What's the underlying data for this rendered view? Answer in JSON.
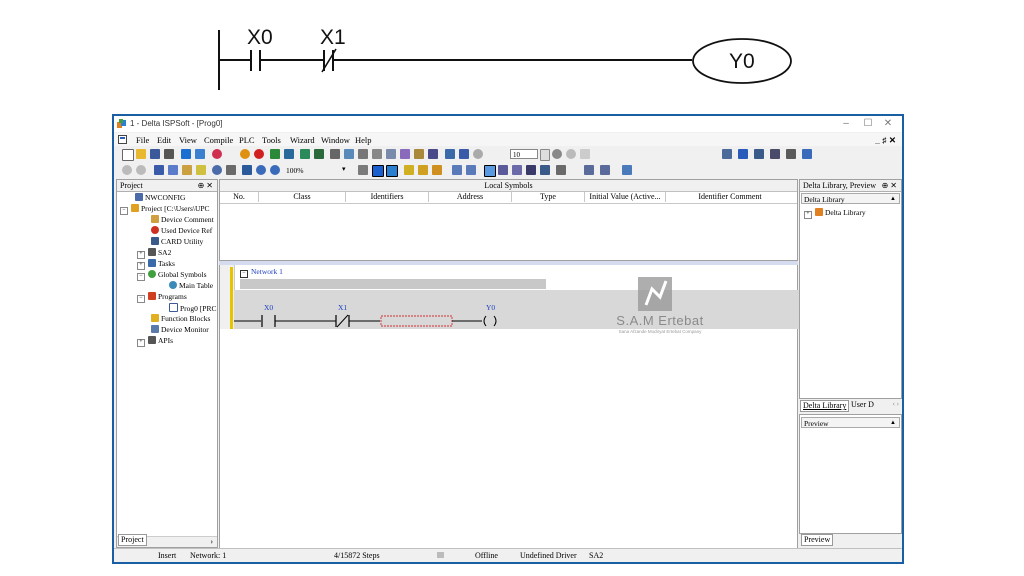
{
  "diagram": {
    "contact_1": "X0",
    "contact_2": "X1",
    "coil": "Y0"
  },
  "window": {
    "title": "1 - Delta ISPSoft - [Prog0]",
    "minimize": "–",
    "maximize": "☐",
    "close": "✕",
    "inner_controls": "_ ♯ ✕"
  },
  "menu": [
    {
      "id": "file",
      "label": "File"
    },
    {
      "id": "edit",
      "label": "Edit"
    },
    {
      "id": "view",
      "label": "View"
    },
    {
      "id": "compile",
      "label": "Compile"
    },
    {
      "id": "plc",
      "label": "PLC"
    },
    {
      "id": "tools",
      "label": "Tools"
    },
    {
      "id": "wizard",
      "label": "Wizard"
    },
    {
      "id": "window",
      "label": "Window"
    },
    {
      "id": "help",
      "label": "Help"
    }
  ],
  "toolbar": {
    "zoom": "100%",
    "spin_value": "10"
  },
  "project_panel": {
    "title": "Project",
    "pin": "⊕ ✕",
    "tree": [
      {
        "label": "NWCONFIG"
      },
      {
        "label": "Project [C:\\Users\\UPC"
      },
      {
        "label": "Device Comment"
      },
      {
        "label": "Used Device Ref"
      },
      {
        "label": "CARD Utility"
      },
      {
        "label": "SA2"
      },
      {
        "label": "Tasks"
      },
      {
        "label": "Global Symbols"
      },
      {
        "label": "Main Table"
      },
      {
        "label": "Programs"
      },
      {
        "label": "Prog0 [PRC"
      },
      {
        "label": "Function Blocks"
      },
      {
        "label": "Device Monitor"
      },
      {
        "label": "APIs"
      }
    ],
    "bottom_tab": "Project"
  },
  "local_symbols": {
    "title": "Local Symbols",
    "columns": [
      "No.",
      "Class",
      "Identifiers",
      "Address",
      "Type",
      "Initial Value (Active...",
      "Identifier Comment"
    ]
  },
  "ladder": {
    "network_label": "Network 1",
    "contact_1": "X0",
    "contact_2": "X1",
    "coil": "Y0"
  },
  "watermark": {
    "name": "S.A.M Ertebat",
    "tagline": "Sana Afzande Modiryat Ertebat Company"
  },
  "library_panel": {
    "title": "Delta Library, Preview",
    "pin": "⊕ ✕",
    "dropdown": "Delta Library",
    "tree_item": "Delta Library",
    "tab_active": "Delta Library",
    "tab_other": "User D",
    "preview_dropdown": "Preview",
    "preview_tab": "Preview"
  },
  "statusbar": {
    "mode": "Insert",
    "network": "Network: 1",
    "steps": "4/15872 Steps",
    "connection": "Offline",
    "driver": "Undefined Driver",
    "plc": "SA2"
  },
  "colors": {
    "window_border": "#1a5fa6",
    "ladder_rail": "#e8c400",
    "ladder_blue": "#1a3ec0",
    "selection_red": "#d03030"
  }
}
